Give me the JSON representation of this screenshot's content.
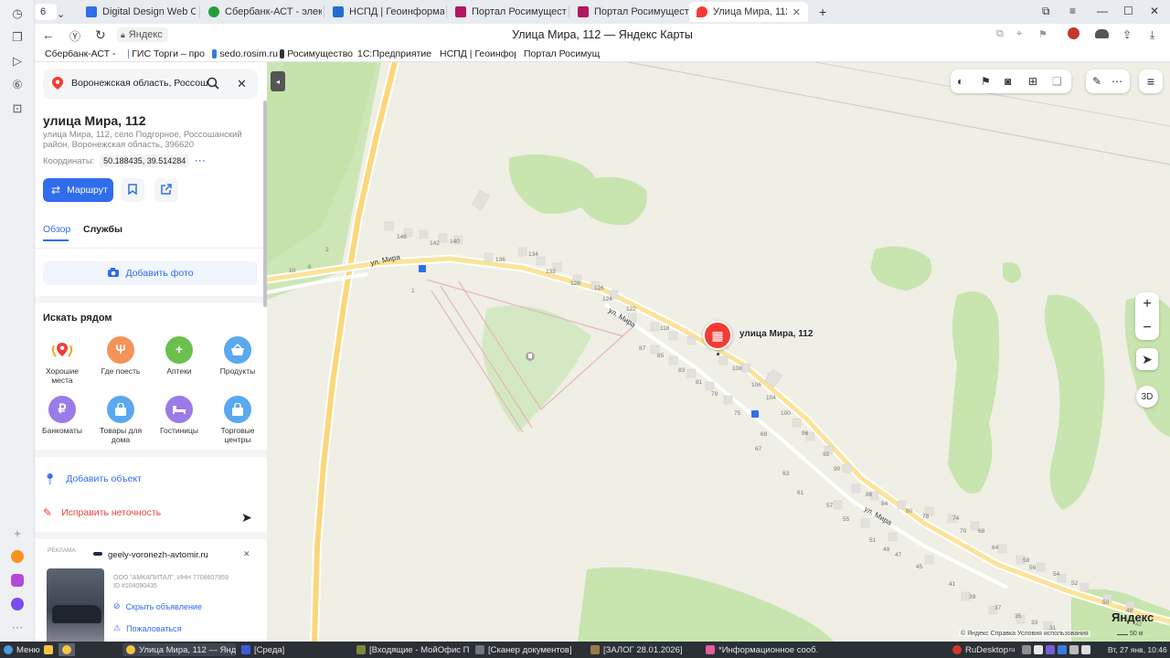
{
  "browser": {
    "tab_count": "6",
    "tabs": [
      {
        "title": "Digital Design Web Client",
        "color": "#2f6ded"
      },
      {
        "title": "Сбербанк-АСТ - электро",
        "color": "#21a038"
      },
      {
        "title": "НСПД | Геоинформацио",
        "color": "#1f6fd1"
      },
      {
        "title": "Портал Росимущества",
        "color": "#b2185f"
      },
      {
        "title": "Портал Росимущества",
        "color": "#b2185f"
      },
      {
        "title": "Улица Мира, 112 — Янд",
        "color": "#f33b33"
      }
    ],
    "address_host": "Яндекс",
    "page_title": "Улица Мира, 112 — Яндекс Карты",
    "bookmarks": [
      {
        "label": "Сбербанк-АСТ -",
        "color": "#21a038"
      },
      {
        "label": "ГИС Торги – про",
        "color": "#6a8fd8"
      },
      {
        "label": "sedo.rosim.ru",
        "color": "#3c78d8"
      },
      {
        "label": "Росимущество",
        "color": "#333333"
      },
      {
        "label": "1С:Предприятие",
        "color": "#e4b200"
      },
      {
        "label": "НСПД | Геоинфор",
        "color": "#1f6fd1"
      },
      {
        "label": "Портал Росимущ",
        "color": "#b2185f"
      }
    ]
  },
  "panel": {
    "search_value": "Воронежская область, Россоша",
    "title": "улица Мира, 112",
    "address": "улица Мира, 112, село Подгорное, Россошанский район, Воронежская область, 396620",
    "coords_label": "Координаты:",
    "coords_value": "50.188435, 39.514284",
    "route_label": "Маршрут",
    "tab_overview": "Обзор",
    "tab_services": "Службы",
    "add_photo": "Добавить фото",
    "nearby_title": "Искать рядом",
    "categories": [
      {
        "label": "Хорошие места",
        "color": "#ffffff",
        "icon": "place-icon"
      },
      {
        "label": "Где поесть",
        "color": "#f5935a",
        "icon": "fork-knife-icon"
      },
      {
        "label": "Аптеки",
        "color": "#6cbf4d",
        "icon": "pharmacy-icon"
      },
      {
        "label": "Продукты",
        "color": "#5aa8f0",
        "icon": "basket-icon"
      },
      {
        "label": "Банкоматы",
        "color": "#9b7be8",
        "icon": "ruble-icon"
      },
      {
        "label": "Товары для дома",
        "color": "#5aa8f0",
        "icon": "bag-icon"
      },
      {
        "label": "Гостиницы",
        "color": "#9b7be8",
        "icon": "bed-icon"
      },
      {
        "label": "Торговые центры",
        "color": "#5aa8f0",
        "icon": "mall-icon"
      }
    ],
    "add_object": "Добавить объект",
    "fix_error": "Исправить неточность",
    "ad": {
      "tag": "РЕКЛАМА",
      "domain": "geely-voronezh-avtomir.ru",
      "legal": "ООО \"АМКАПИТАЛ\", ИНН 7708607959",
      "id": "ID #104090435",
      "hide": "Скрыть объявление",
      "report": "Пожаловаться"
    }
  },
  "map": {
    "pin_label": "улица Мира, 112",
    "street_label": "ул. Мира",
    "logo": "Яндекс",
    "copyright": "© Яндекс  Справка  Условия использования",
    "scale": "50 м",
    "threed": "3D",
    "house_numbers": [
      {
        "n": "146"
      },
      {
        "n": "142"
      },
      {
        "n": "140"
      },
      {
        "n": "136"
      },
      {
        "n": "134"
      },
      {
        "n": "132"
      },
      {
        "n": "128"
      },
      {
        "n": "126"
      },
      {
        "n": "124"
      },
      {
        "n": "122"
      },
      {
        "n": "118"
      },
      {
        "n": "108"
      },
      {
        "n": "106"
      },
      {
        "n": "104"
      },
      {
        "n": "100"
      },
      {
        "n": "96"
      },
      {
        "n": "92"
      },
      {
        "n": "90"
      },
      {
        "n": "87"
      },
      {
        "n": "85"
      },
      {
        "n": "83"
      },
      {
        "n": "81"
      },
      {
        "n": "79"
      },
      {
        "n": "75"
      },
      {
        "n": "69"
      },
      {
        "n": "67"
      },
      {
        "n": "63"
      },
      {
        "n": "61"
      },
      {
        "n": "57"
      },
      {
        "n": "55"
      },
      {
        "n": "51"
      },
      {
        "n": "49"
      },
      {
        "n": "47"
      },
      {
        "n": "45"
      },
      {
        "n": "41"
      },
      {
        "n": "39"
      },
      {
        "n": "37"
      },
      {
        "n": "35"
      },
      {
        "n": "33"
      },
      {
        "n": "31"
      },
      {
        "n": "86"
      },
      {
        "n": "84"
      },
      {
        "n": "80"
      },
      {
        "n": "78"
      },
      {
        "n": "74"
      },
      {
        "n": "70"
      },
      {
        "n": "68"
      },
      {
        "n": "64"
      },
      {
        "n": "58"
      },
      {
        "n": "56"
      },
      {
        "n": "54"
      },
      {
        "n": "52"
      },
      {
        "n": "50"
      },
      {
        "n": "48"
      },
      {
        "n": "42"
      },
      {
        "n": "10"
      },
      {
        "n": "6"
      },
      {
        "n": "2"
      },
      {
        "n": "1"
      }
    ]
  },
  "taskbar": {
    "menu": "Меню",
    "items": [
      {
        "label": "Улица Мира, 112 — Янде...",
        "color": "#f5c542",
        "active": true
      },
      {
        "label": "[Среда]",
        "color": "#3b5bdb",
        "active": false
      },
      {
        "label": "[Входящие - МойОфис П...",
        "color": "#7b8a3a",
        "active": false
      },
      {
        "label": "[Сканер документов]",
        "color": "#6d7782",
        "active": false
      },
      {
        "label": "[ЗАЛОГ 28.01.2026]",
        "color": "#9b7a4a",
        "active": false
      },
      {
        "label": "*Информационное сооб...",
        "color": "#e45c9c",
        "active": false
      }
    ],
    "tray_app": "RuDesktop",
    "lang": "ru",
    "clock": "Вт, 27 янв, 10:46"
  }
}
